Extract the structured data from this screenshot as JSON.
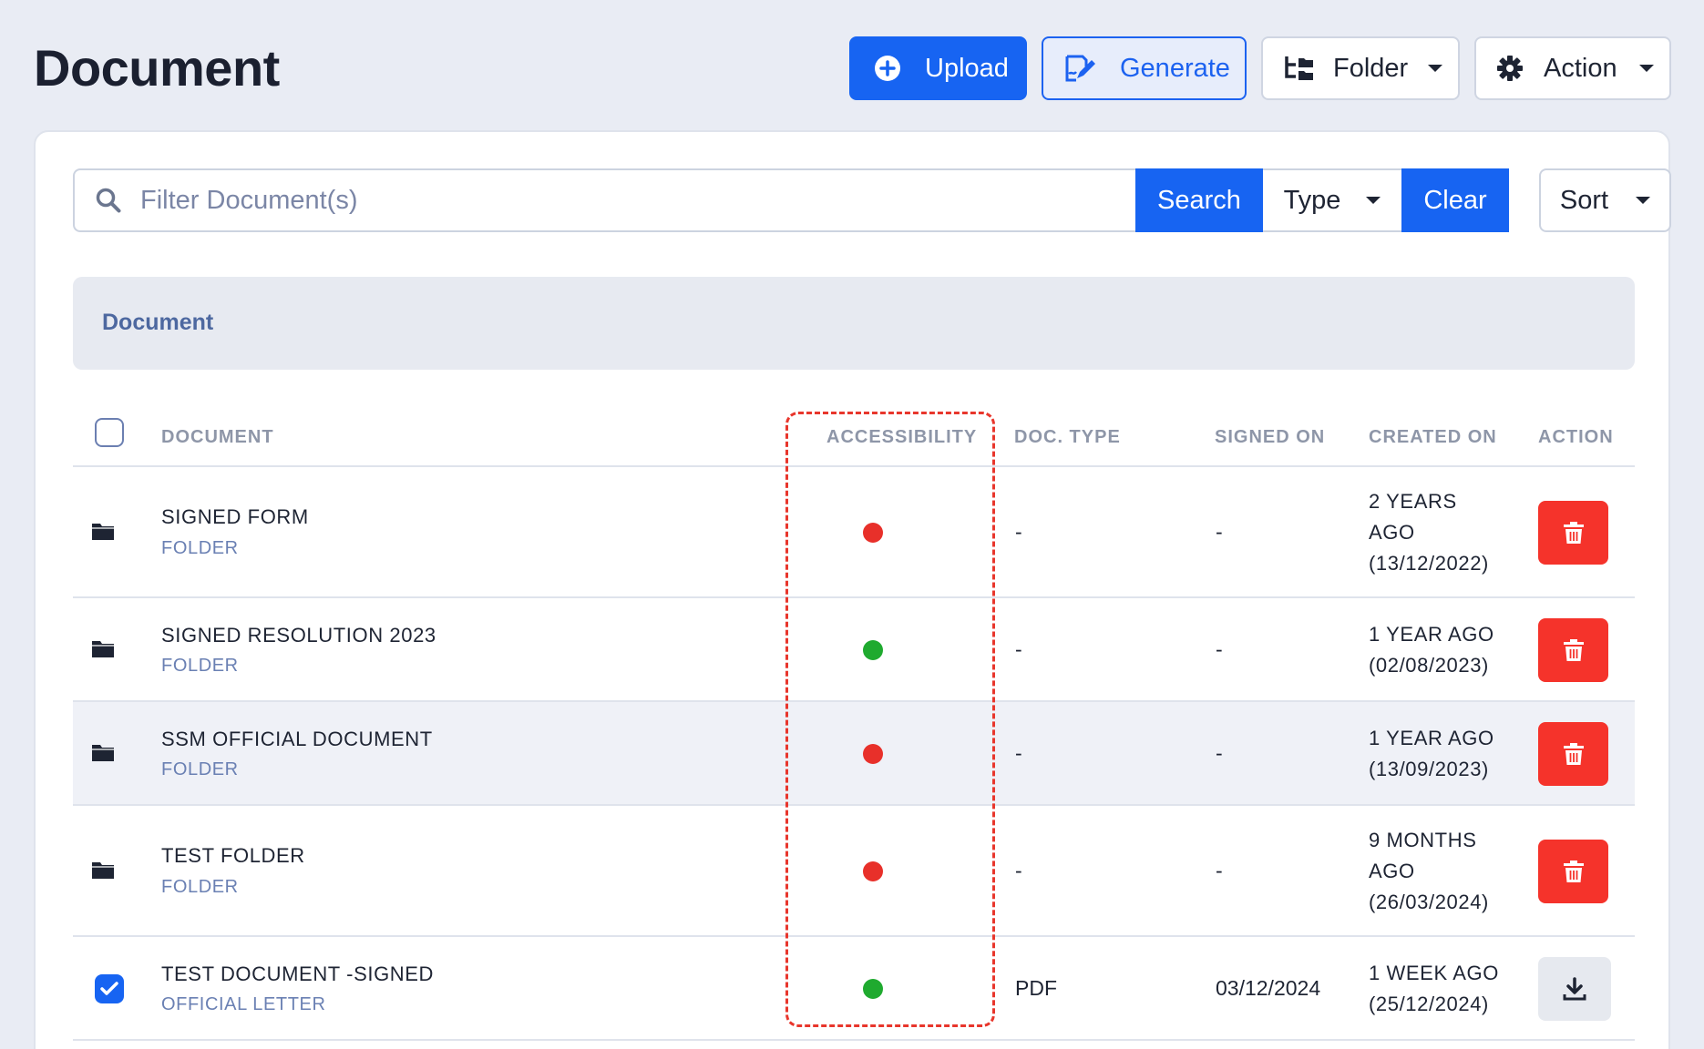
{
  "page": {
    "title": "Document"
  },
  "toolbar": {
    "upload_label": "Upload",
    "generate_label": "Generate",
    "folder_label": "Folder",
    "action_label": "Action"
  },
  "filter": {
    "placeholder": "Filter Document(s)",
    "search_label": "Search",
    "type_label": "Type",
    "clear_label": "Clear",
    "sort_label": "Sort"
  },
  "section": {
    "title": "Document"
  },
  "table": {
    "columns": {
      "document": "DOCUMENT",
      "accessibility": "ACCESSIBILITY",
      "doc_type": "DOC. TYPE",
      "signed_on": "SIGNED ON",
      "created_on": "CREATED ON",
      "action": "ACTION"
    },
    "rows": [
      {
        "name": "SIGNED FORM",
        "subtype": "FOLDER",
        "accessibility": "red",
        "doc_type": "-",
        "signed_on": "-",
        "created_line1": "2 YEARS",
        "created_line2": "AGO",
        "created_line3": "(13/12/2022)",
        "action": "delete"
      },
      {
        "name": "SIGNED RESOLUTION 2023",
        "subtype": "FOLDER",
        "accessibility": "green",
        "doc_type": "-",
        "signed_on": "-",
        "created_line1": "1 YEAR AGO",
        "created_line2": "(02/08/2023)",
        "created_line3": "",
        "action": "delete"
      },
      {
        "name": "SSM OFFICIAL DOCUMENT",
        "subtype": "FOLDER",
        "accessibility": "red",
        "doc_type": "-",
        "signed_on": "-",
        "created_line1": "1 YEAR AGO",
        "created_line2": "(13/09/2023)",
        "created_line3": "",
        "action": "delete"
      },
      {
        "name": "TEST FOLDER",
        "subtype": "FOLDER",
        "accessibility": "red",
        "doc_type": "-",
        "signed_on": "-",
        "created_line1": "9 MONTHS",
        "created_line2": "AGO",
        "created_line3": "(26/03/2024)",
        "action": "delete"
      },
      {
        "name": "TEST DOCUMENT -SIGNED",
        "subtype": "OFFICIAL LETTER",
        "accessibility": "green",
        "doc_type": "PDF",
        "signed_on": "03/12/2024",
        "created_line1": "1 WEEK AGO",
        "created_line2": "(25/12/2024)",
        "created_line3": "",
        "action": "download"
      }
    ]
  },
  "colors": {
    "primary": "#1764f2",
    "danger": "#f5332b",
    "status_red": "#e8302a",
    "status_green": "#1faa2f",
    "highlight": "#e8362c"
  },
  "icons": {
    "upload": "plus-circle-icon",
    "generate": "signature-edit-icon",
    "folder": "folder-tree-icon",
    "action": "gear-icon",
    "search": "search-icon",
    "row_folder": "folder-icon",
    "delete": "trash-icon",
    "download": "download-icon",
    "checked": "check-icon"
  }
}
